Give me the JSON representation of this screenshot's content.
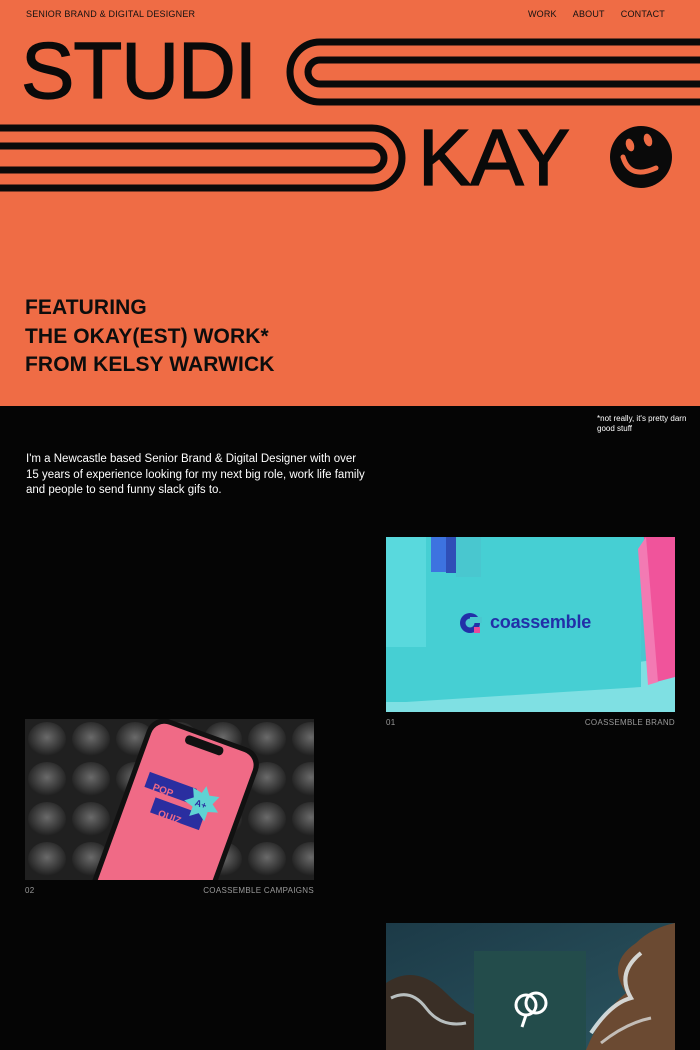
{
  "header": {
    "role": "SENIOR BRAND & DIGITAL DESIGNER",
    "nav": [
      "WORK",
      "ABOUT",
      "CONTACT"
    ]
  },
  "brand": {
    "word_1": "STUDI",
    "word_2": "KAY",
    "smiley_icon": "smiley-face-icon"
  },
  "featuring": {
    "line_1": "FEATURING",
    "line_2": "THE OKAY(EST) WORK*",
    "line_3": "FROM KELSY WARWICK"
  },
  "footnote": "*not really, it's pretty darn good stuff",
  "intro": "I'm a Newcastle based Senior Brand & Digital Designer with over 15 years of experience looking for my next big role, work life family and people to send funny slack gifs to.",
  "projects": [
    {
      "number": "01",
      "title": "COASSEMBLE BRAND",
      "image_text": "coassemble"
    },
    {
      "number": "02",
      "title": "COASSEMBLE CAMPAIGNS",
      "image_text_1": "POP",
      "image_text_2": "QUIZ",
      "image_badge": "A+"
    },
    {
      "number": "",
      "title": ""
    }
  ],
  "colors": {
    "hero_bg": "#ef6c45",
    "page_bg": "#050505",
    "text_dark": "#0a0a0a",
    "meta_gray": "#9a9a9a"
  }
}
